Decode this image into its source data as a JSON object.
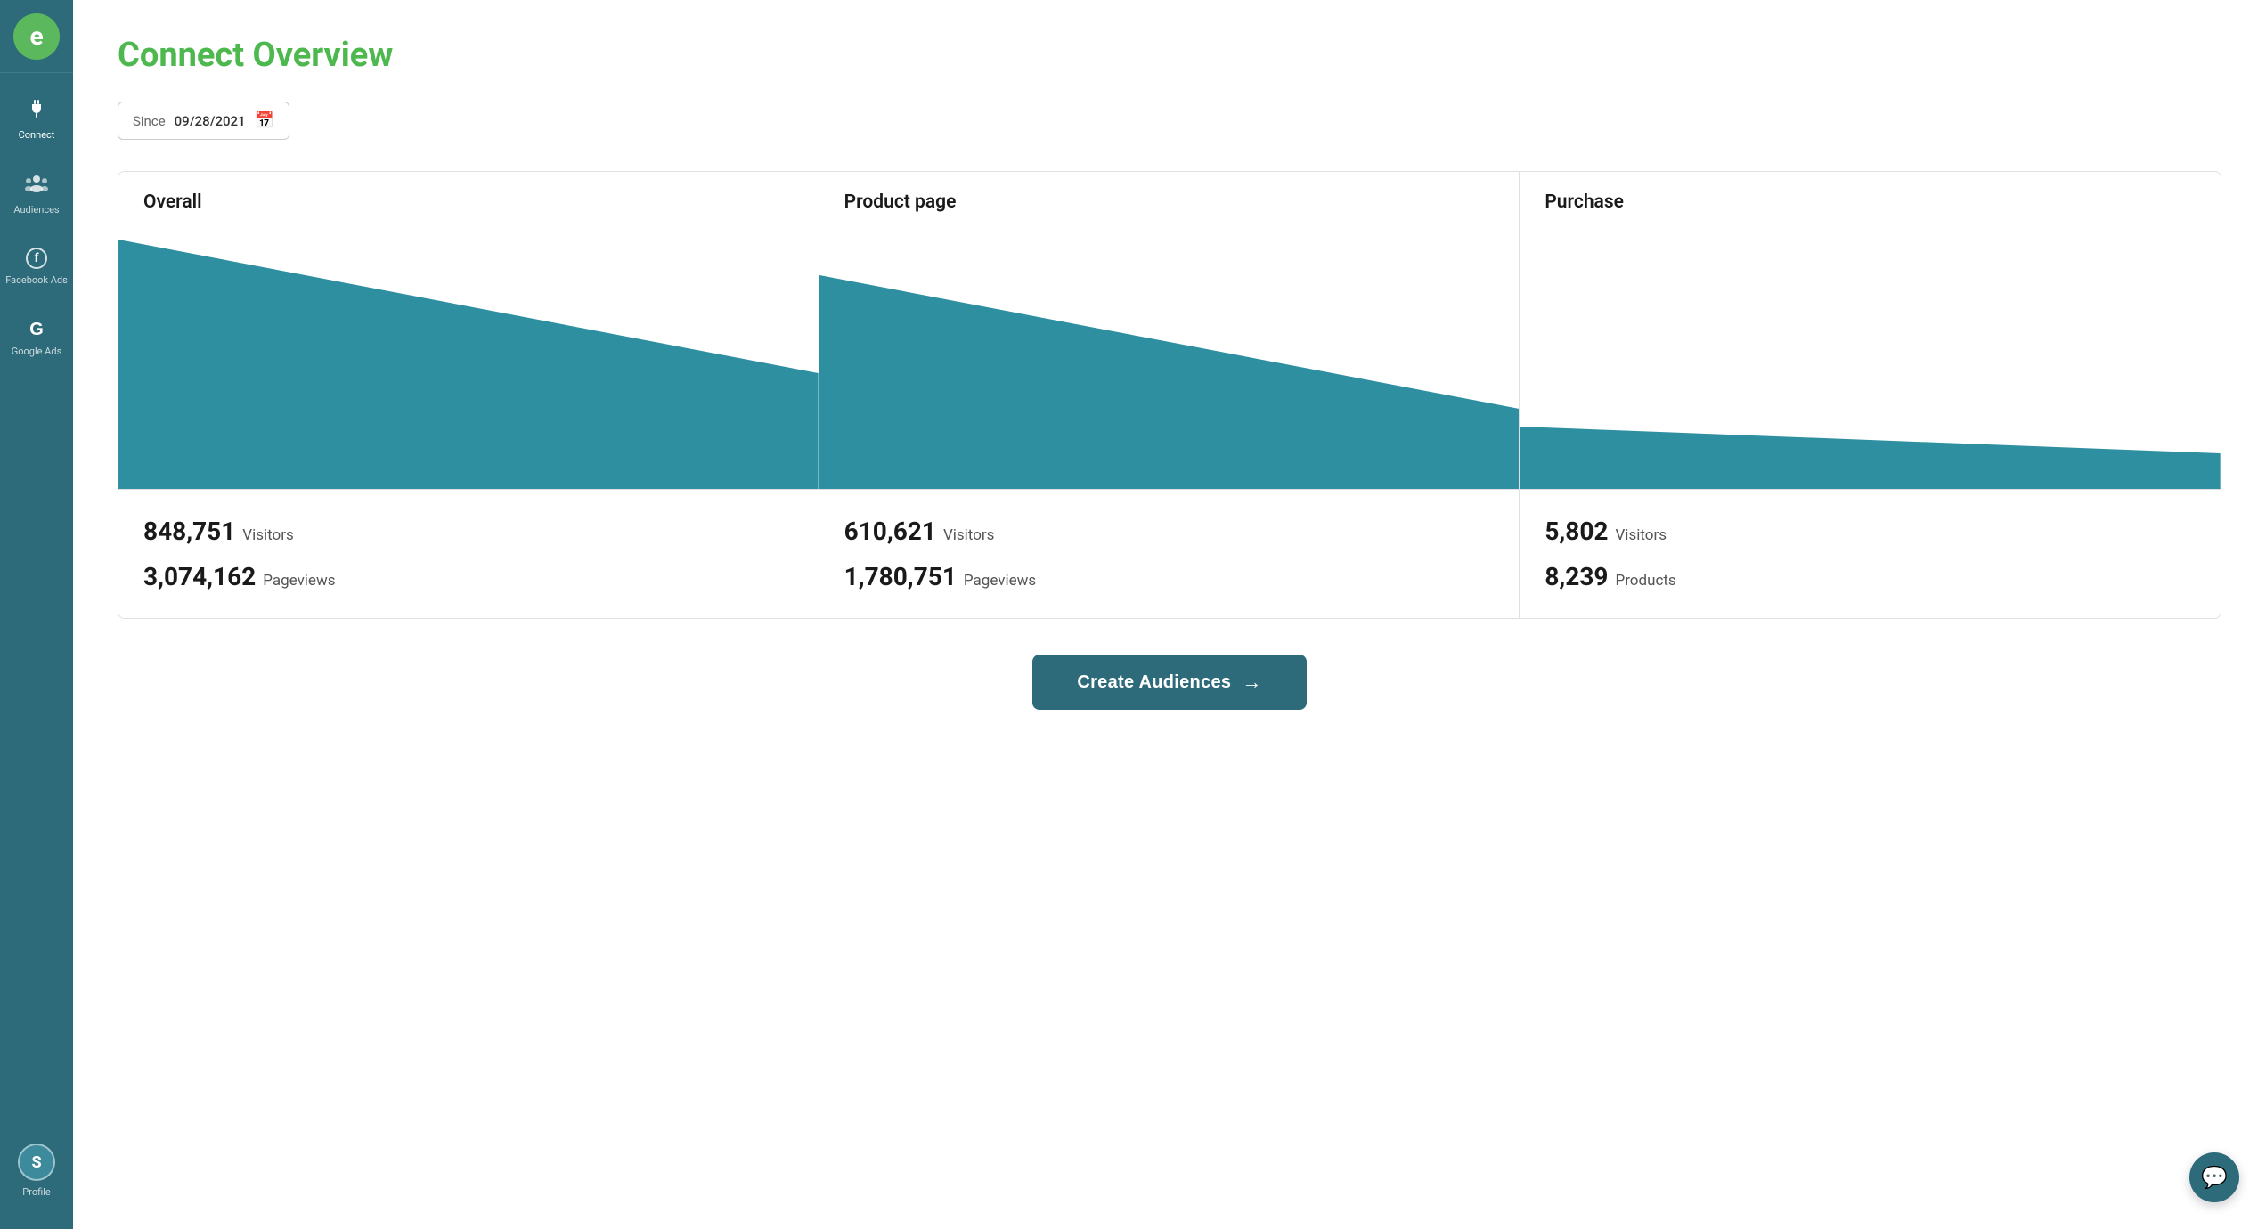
{
  "sidebar": {
    "logo_letter": "e",
    "items": [
      {
        "id": "connect",
        "label": "Connect",
        "icon": "plug",
        "active": true
      },
      {
        "id": "audiences",
        "label": "Audiences",
        "icon": "people"
      },
      {
        "id": "facebook-ads",
        "label": "Facebook Ads",
        "icon": "facebook"
      },
      {
        "id": "google-ads",
        "label": "Google Ads",
        "icon": "google"
      }
    ],
    "profile": {
      "label": "Profile",
      "initial": "S"
    }
  },
  "header": {
    "title": "Connect Overview"
  },
  "date_filter": {
    "since_label": "Since",
    "date_value": "09/28/2021"
  },
  "funnel": {
    "sections": [
      {
        "id": "overall",
        "title": "Overall",
        "stats": [
          {
            "number": "848,751",
            "label": "Visitors"
          },
          {
            "number": "3,074,162",
            "label": "Pageviews"
          }
        ]
      },
      {
        "id": "product-page",
        "title": "Product page",
        "stats": [
          {
            "number": "610,621",
            "label": "Visitors"
          },
          {
            "number": "1,780,751",
            "label": "Pageviews"
          }
        ]
      },
      {
        "id": "purchase",
        "title": "Purchase",
        "stats": [
          {
            "number": "5,802",
            "label": "Visitors"
          },
          {
            "number": "8,239",
            "label": "Products"
          }
        ]
      }
    ]
  },
  "cta": {
    "button_label": "Create Audiences",
    "arrow": "→"
  },
  "chat_widget": {
    "icon": "💬"
  },
  "colors": {
    "sidebar_bg": "#2d6b7a",
    "logo_green": "#5cb85c",
    "title_green": "#4db84d",
    "teal_fill": "#2d8fa0",
    "border": "#e0e0e0"
  }
}
